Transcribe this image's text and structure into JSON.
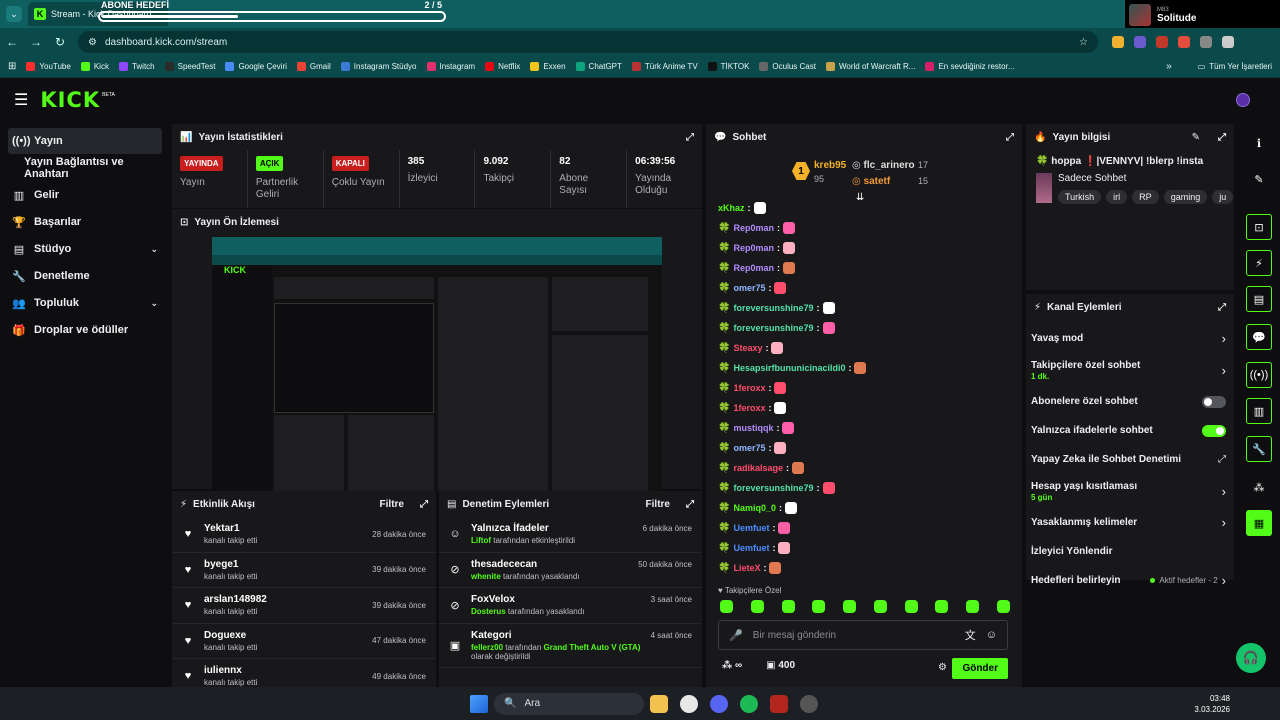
{
  "browser": {
    "tab_title": "Stream - Kick Dashboard",
    "url": "dashboard.kick.com/stream",
    "goal_overlay": {
      "title": "ABONE HEDEFİ",
      "count": "2 / 5",
      "progress": 0.4
    },
    "media": {
      "subtitle": "M83",
      "title": "Solitude"
    },
    "bookmarks": [
      "YouTube",
      "Kick",
      "Twitch",
      "SpeedTest",
      "Google Çeviri",
      "Gmail",
      "Instagram Stüdyo",
      "Instagram",
      "Netflix",
      "Exxen",
      "ChatGPT",
      "Türk Anime TV",
      "TİKTOK",
      "Oculus Cast",
      "World of Warcraft R...",
      "En sevdiğiniz restor..."
    ],
    "bookmarks_folder": "Tüm Yer İşaretleri",
    "bookmark_colors": [
      "#ff2d2d",
      "#53fc18",
      "#9146ff",
      "#2b2b2b",
      "#4a8cff",
      "#ea4335",
      "#3a7bd5",
      "#e1306c",
      "#e50914",
      "#f5c518",
      "#10a37f",
      "#b83232",
      "#111111",
      "#666666",
      "#c8a14b",
      "#d61f69"
    ]
  },
  "header": {
    "logo": "KICK",
    "beta": "BETA"
  },
  "sidebar": {
    "items": [
      {
        "label": "Yayın",
        "icon": "broadcast-icon",
        "glyph": "((•))"
      },
      {
        "label": "Yayın Bağlantısı ve Anahtarı",
        "icon": "",
        "glyph": ""
      },
      {
        "label": "Gelir",
        "icon": "revenue-icon",
        "glyph": "▥"
      },
      {
        "label": "Başarılar",
        "icon": "trophy-icon",
        "glyph": "🏆"
      },
      {
        "label": "Stüdyo",
        "icon": "studio-icon",
        "glyph": "▤"
      },
      {
        "label": "Denetleme",
        "icon": "wrench-icon",
        "glyph": "🔧"
      },
      {
        "label": "Topluluk",
        "icon": "community-icon",
        "glyph": "👥"
      },
      {
        "label": "Droplar ve ödüller",
        "icon": "gift-icon",
        "glyph": "🎁"
      }
    ]
  },
  "stats": {
    "title": "Yayın İstatistikleri",
    "items": [
      {
        "value": "YAYINDA",
        "label": "Yayın",
        "badge": "red"
      },
      {
        "value": "AÇIK",
        "label": "Partnerlik Geliri",
        "badge": "green"
      },
      {
        "value": "KAPALI",
        "label": "Çoklu Yayın",
        "badge": "red"
      },
      {
        "value": "385",
        "label": "İzleyici",
        "badge": ""
      },
      {
        "value": "9.092",
        "label": "Takipçi",
        "badge": ""
      },
      {
        "value": "82",
        "label": "Abone Sayısı",
        "badge": ""
      },
      {
        "value": "06:39:56",
        "label": "Yayında Olduğu",
        "badge": ""
      }
    ]
  },
  "preview": {
    "title": "Yayın Ön İzlemesi"
  },
  "activity": {
    "title": "Etkinlik Akışı",
    "filter": "Filtre",
    "items": [
      {
        "name": "Yektar1",
        "sub": "kanalı takip etti",
        "time": "28 dakika önce"
      },
      {
        "name": "byege1",
        "sub": "kanalı takip etti",
        "time": "39 dakika önce"
      },
      {
        "name": "arslan148982",
        "sub": "kanalı takip etti",
        "time": "39 dakika önce"
      },
      {
        "name": "Doguexe",
        "sub": "kanalı takip etti",
        "time": "47 dakika önce"
      },
      {
        "name": "iuliennx",
        "sub": "kanalı takip etti",
        "time": "49 dakika önce"
      }
    ]
  },
  "moderation": {
    "title": "Denetim Eylemleri",
    "filter": "Filtre",
    "items": [
      {
        "icon": "smile-icon",
        "glyph": "☺",
        "name": "Yalnızca İfadeler",
        "actor": "Liftof",
        "sub": "tarafından etkinleştirildi",
        "extra": "",
        "extra2": "",
        "time": "6 dakika önce"
      },
      {
        "icon": "ban-icon",
        "glyph": "⊘",
        "name": "thesadececan",
        "actor": "whenite",
        "sub": "tarafından yasaklandı",
        "extra": "",
        "extra2": "",
        "time": "50 dakika önce"
      },
      {
        "icon": "ban-icon",
        "glyph": "⊘",
        "name": "FoxVelox",
        "actor": "Dosterus",
        "sub": "tarafından yasaklandı",
        "extra": "",
        "extra2": "",
        "time": "3 saat önce"
      },
      {
        "icon": "category-icon",
        "glyph": "▣",
        "name": "Kategori",
        "actor": "fellerz00",
        "sub": "tarafından",
        "extra": "Grand Theft Auto V (GTA)",
        "extra2": "olarak değiştirildi",
        "time": "4 saat önce"
      }
    ]
  },
  "chat": {
    "title": "Sohbet",
    "leaders": [
      {
        "rank": "1",
        "name": "kreb95",
        "count": "95"
      },
      {
        "name": "flc_arinero",
        "count": "17"
      },
      {
        "name": "satetf",
        "count": "15"
      }
    ],
    "messages": [
      {
        "user": "xKhaz",
        "color": "#53fc18"
      },
      {
        "user": "Rep0man",
        "color": "#b28cff"
      },
      {
        "user": "Rep0man",
        "color": "#b28cff"
      },
      {
        "user": "Rep0man",
        "color": "#b28cff"
      },
      {
        "user": "omer75",
        "color": "#8fb7ff"
      },
      {
        "user": "foreversunshine79",
        "color": "#53e0a8"
      },
      {
        "user": "foreversunshine79",
        "color": "#53e0a8"
      },
      {
        "user": "Steaxy",
        "color": "#ff4d6d"
      },
      {
        "user": "Hesapsirfbununicinacildi0",
        "color": "#53e0a8"
      },
      {
        "user": "1feroxx",
        "color": "#ff4d6d"
      },
      {
        "user": "1feroxx",
        "color": "#ff4d6d"
      },
      {
        "user": "mustiqqk",
        "color": "#b28cff"
      },
      {
        "user": "omer75",
        "color": "#8fb7ff"
      },
      {
        "user": "radikalsage",
        "color": "#ff4d6d"
      },
      {
        "user": "foreversunshine79",
        "color": "#53e0a8"
      },
      {
        "user": "Namiq0_0",
        "color": "#53fc18"
      },
      {
        "user": "Uemfuet",
        "color": "#4b8cff"
      },
      {
        "user": "Uemfuet",
        "color": "#4b8cff"
      },
      {
        "user": "LieteX",
        "color": "#ff4d6d"
      }
    ],
    "followers_only_label": "Takipçilere Özel",
    "input_placeholder": "Bir mesaj gönderin",
    "points": "400",
    "send": "Gönder"
  },
  "stream_info": {
    "title": "Yayın bilgisi",
    "stream_title": "hoppa ❗|VENNYV| !blerp !insta",
    "category": "Sadece Sohbet",
    "tags": [
      "Turkish",
      "irl",
      "RP",
      "gaming",
      "ju"
    ]
  },
  "channel_actions": {
    "title": "Kanal Eylemleri",
    "items": [
      {
        "label": "Yavaş mod",
        "sub": "",
        "control": "chevron"
      },
      {
        "label": "Takipçilere özel sohbet",
        "sub": "1 dk.",
        "control": "chevron"
      },
      {
        "label": "Abonelere özel sohbet",
        "sub": "",
        "control": "toggle-off"
      },
      {
        "label": "Yalnızca ifadelerle sohbet",
        "sub": "",
        "control": "toggle-on"
      },
      {
        "label": "Yapay Zeka ile Sohbet Denetimi",
        "sub": "",
        "control": "external"
      },
      {
        "label": "Hesap yaşı kısıtlaması",
        "sub": "5 gün",
        "control": "chevron"
      },
      {
        "label": "Yasaklanmış kelimeler",
        "sub": "",
        "control": "chevron"
      },
      {
        "label": "İzleyici Yönlendir",
        "sub": "",
        "control": "none"
      },
      {
        "label": "Hedefleri belirleyin",
        "sub": "",
        "control": "goal",
        "status": "Aktif hedefler - 2"
      }
    ]
  },
  "taskbar": {
    "search": "Ara",
    "time": "03:48",
    "date": "3.03.2026"
  }
}
